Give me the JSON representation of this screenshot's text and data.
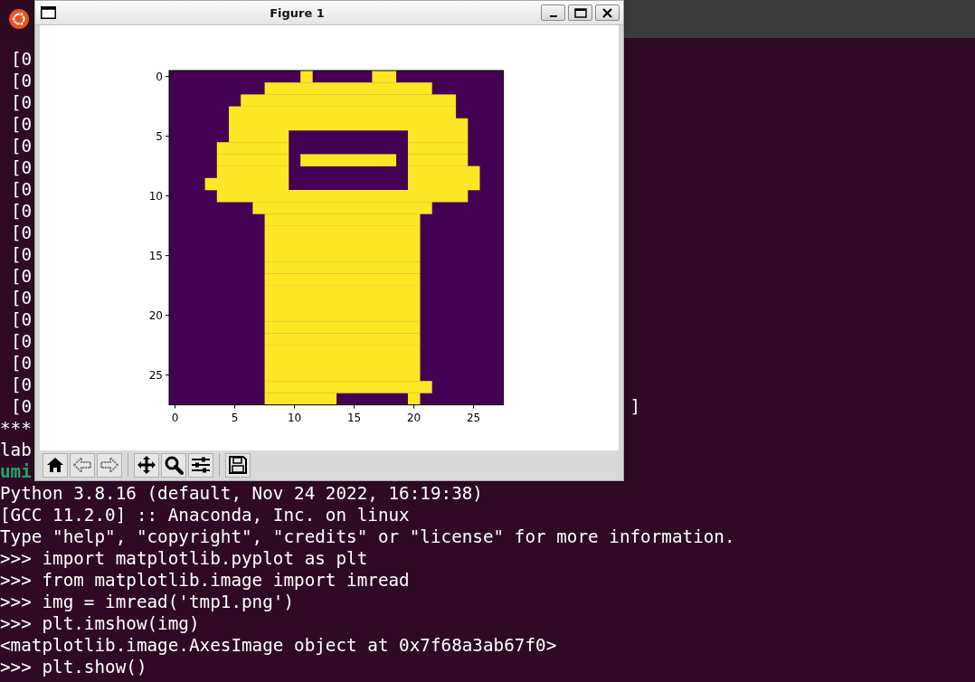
{
  "terminal": {
    "lines": [
      {
        "text": "[0",
        "kind": "array_row"
      },
      {
        "text": "[0",
        "kind": "array_row"
      },
      {
        "text": "[0",
        "kind": "array_row"
      },
      {
        "text": "[0",
        "kind": "array_row"
      },
      {
        "text": "[0",
        "kind": "array_row"
      },
      {
        "text": "[0",
        "kind": "array_row"
      },
      {
        "text": "[0",
        "kind": "array_row"
      },
      {
        "text": "[0",
        "kind": "array_row"
      },
      {
        "text": "[0",
        "kind": "array_row"
      },
      {
        "text": "[0",
        "kind": "array_row"
      },
      {
        "text": "[0",
        "kind": "array_row"
      },
      {
        "text": "[0",
        "kind": "array_row"
      },
      {
        "text": "[0",
        "kind": "array_row"
      },
      {
        "text": "[0",
        "kind": "array_row"
      },
      {
        "text": "[0",
        "kind": "array_row"
      },
      {
        "text": "[0",
        "kind": "array_row"
      },
      {
        "text": "[0",
        "kind": "array_row",
        "tail": "]"
      },
      {
        "text": "***",
        "kind": "output"
      },
      {
        "text": "lab",
        "kind": "output"
      },
      {
        "text": "umi",
        "kind": "user_prompt"
      },
      {
        "text": "Python 3.8.16 (default, Nov 24 2022, 16:19:38)",
        "kind": "output"
      },
      {
        "text": "[GCC 11.2.0] :: Anaconda, Inc. on linux",
        "kind": "output"
      },
      {
        "text": "Type \"help\", \"copyright\", \"credits\" or \"license\" for more information.",
        "kind": "output"
      },
      {
        "text": ">>> import matplotlib.pyplot as plt",
        "kind": "output"
      },
      {
        "text": ">>> from matplotlib.image import imread",
        "kind": "output"
      },
      {
        "text": ">>> img = imread('tmp1.png')",
        "kind": "output"
      },
      {
        "text": ">>> plt.imshow(img)",
        "kind": "output"
      },
      {
        "text": "<matplotlib.image.AxesImage object at 0x7f68a3ab67f0>",
        "kind": "output"
      },
      {
        "text": ">>> plt.show()",
        "kind": "output"
      }
    ]
  },
  "figure_window": {
    "title": "Figure 1",
    "plot": {
      "yticks": [
        "0",
        "5",
        "10",
        "15",
        "20",
        "25"
      ],
      "xticks": [
        "0",
        "5",
        "10",
        "15",
        "20",
        "25"
      ]
    },
    "toolbar": {
      "groups": [
        [
          {
            "kind": "home",
            "disabled": false
          },
          {
            "kind": "back",
            "disabled": true
          },
          {
            "kind": "forward",
            "disabled": true
          }
        ],
        [
          {
            "kind": "pan",
            "disabled": false
          },
          {
            "kind": "zoom",
            "disabled": false
          },
          {
            "kind": "configure",
            "disabled": false
          }
        ],
        [
          {
            "kind": "save",
            "disabled": false
          }
        ]
      ]
    }
  }
}
